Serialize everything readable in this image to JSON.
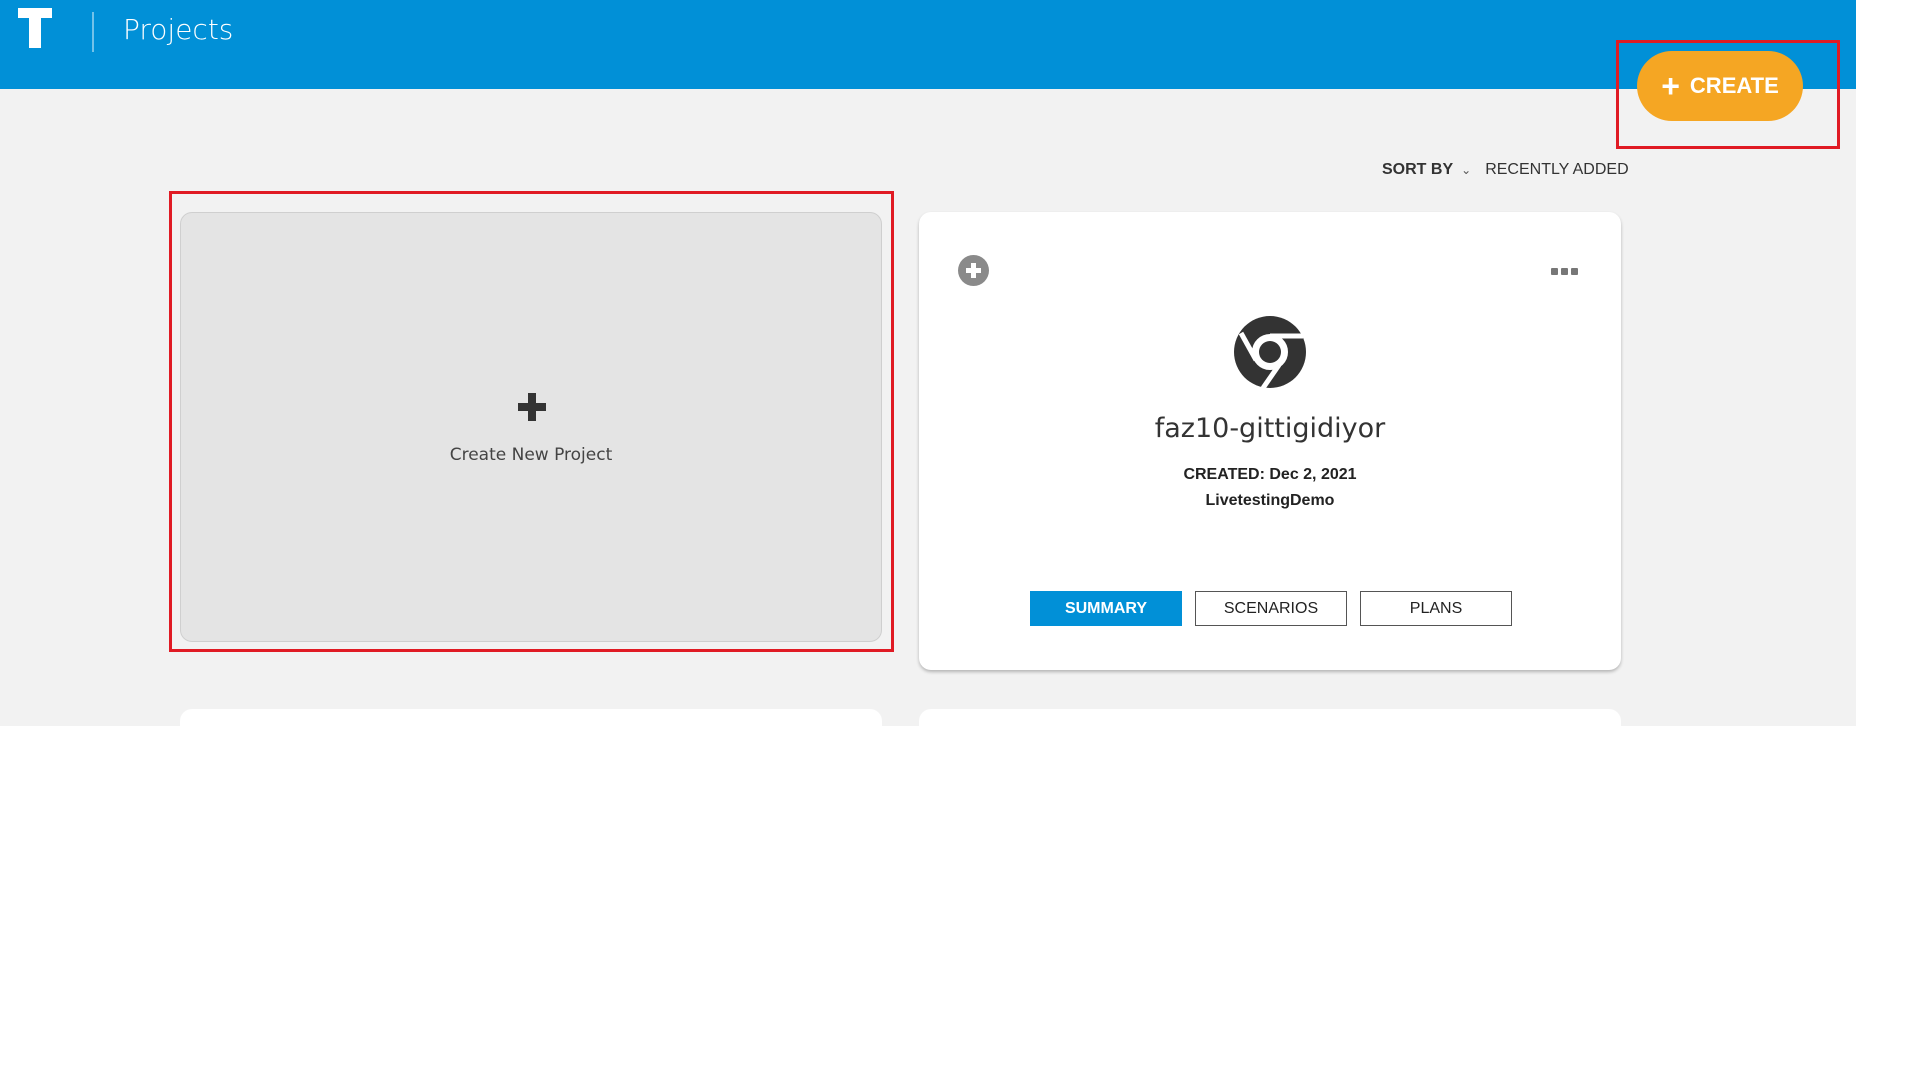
{
  "header": {
    "logo_icon": "t-logo-icon",
    "title": "Projects",
    "background": "#0190d7"
  },
  "toolbar": {
    "create_label": "CREATE",
    "create_icon": "plus-icon",
    "create_color": "#f5a623"
  },
  "sort": {
    "label": "SORT BY",
    "chevron_icon": "chevron-down-icon",
    "value": "RECENTLY ADDED"
  },
  "new_project_card": {
    "icon": "plus-icon",
    "label": "Create New Project"
  },
  "projects": [
    {
      "name": "faz10-gittigidiyor",
      "created": "CREATED: Dec 2, 2021",
      "team": "LivetestingDemo",
      "browser_icon": "chrome-icon",
      "add_icon": "circle-plus-icon",
      "menu_icon": "more-dots-icon",
      "tabs": [
        {
          "label": "SUMMARY",
          "active": true
        },
        {
          "label": "SCENARIOS",
          "active": false
        },
        {
          "label": "PLANS",
          "active": false
        }
      ]
    }
  ]
}
